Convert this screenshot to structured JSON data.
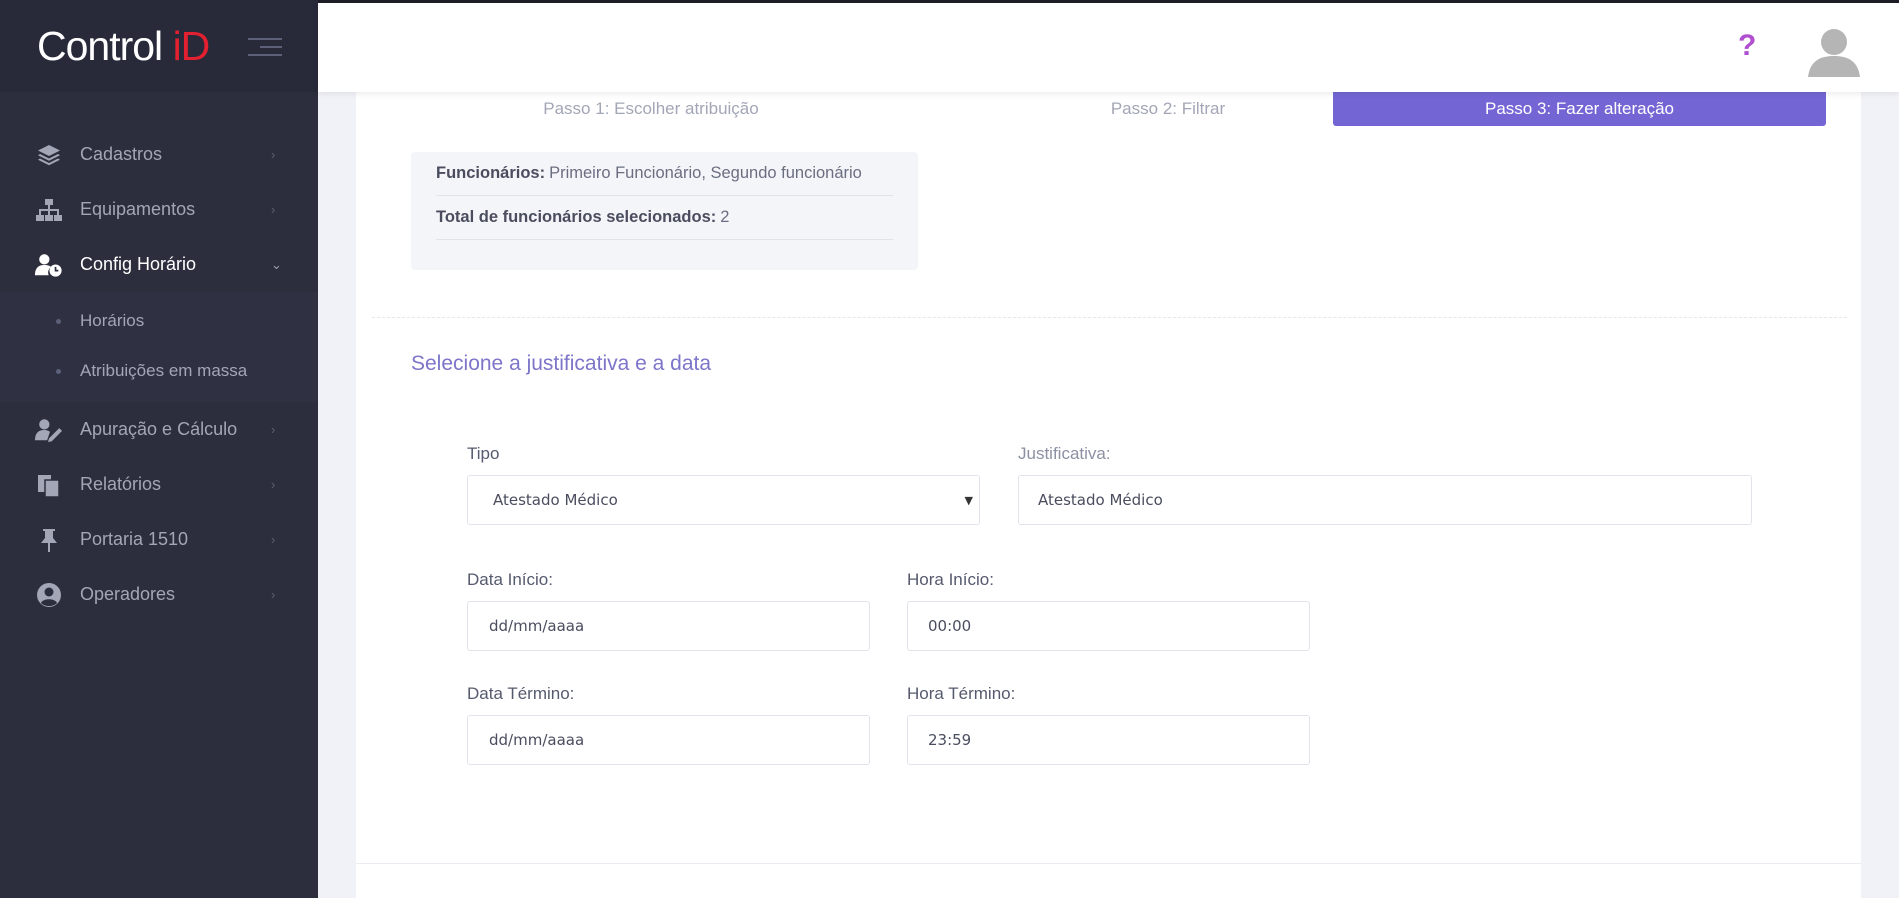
{
  "brand": {
    "logo_main": "Control ",
    "logo_accent": "iD"
  },
  "sidebar": {
    "items": [
      {
        "label": "Cadastros",
        "icon": "layers-icon"
      },
      {
        "label": "Equipamentos",
        "icon": "sitemap-icon"
      },
      {
        "label": "Config Horário",
        "icon": "user-clock-icon",
        "active": true,
        "children": [
          {
            "label": "Horários"
          },
          {
            "label": "Atribuições em massa"
          }
        ]
      },
      {
        "label": "Apuração e Cálculo",
        "icon": "user-edit-icon"
      },
      {
        "label": "Relatórios",
        "icon": "copy-icon"
      },
      {
        "label": "Portaria 1510",
        "icon": "thumbtack-icon"
      },
      {
        "label": "Operadores",
        "icon": "user-circle-icon"
      }
    ]
  },
  "topbar": {
    "help_label": "?"
  },
  "steps": [
    {
      "label": "Passo 1: Escolher atribuição"
    },
    {
      "label": "Passo 2: Filtrar"
    },
    {
      "label": "Passo 3: Fazer alteração",
      "active": true
    }
  ],
  "summary": {
    "employees_label": "Funcionários:",
    "employees_value": "Primeiro Funcionário, Segundo funcionário",
    "total_label": "Total de funcionários selecionados:",
    "total_value": "2"
  },
  "section_title": "Selecione a justificativa e a data",
  "form": {
    "tipo": {
      "label": "Tipo",
      "value": "Atestado Médico"
    },
    "justificativa": {
      "label": "Justificativa:",
      "value": "Atestado Médico"
    },
    "data_inicio": {
      "label": "Data Início:",
      "value": "dd/mm/aaaa"
    },
    "hora_inicio": {
      "label": "Hora Início:",
      "value": "00:00"
    },
    "data_termino": {
      "label": "Data Término:",
      "value": "dd/mm/aaaa"
    },
    "hora_termino": {
      "label": "Hora Término:",
      "value": "23:59"
    }
  },
  "colors": {
    "sidebar_bg": "#2c2e3e",
    "accent_purple": "#7366d4",
    "logo_red": "#e2202f",
    "help_purple": "#b04fd0"
  }
}
